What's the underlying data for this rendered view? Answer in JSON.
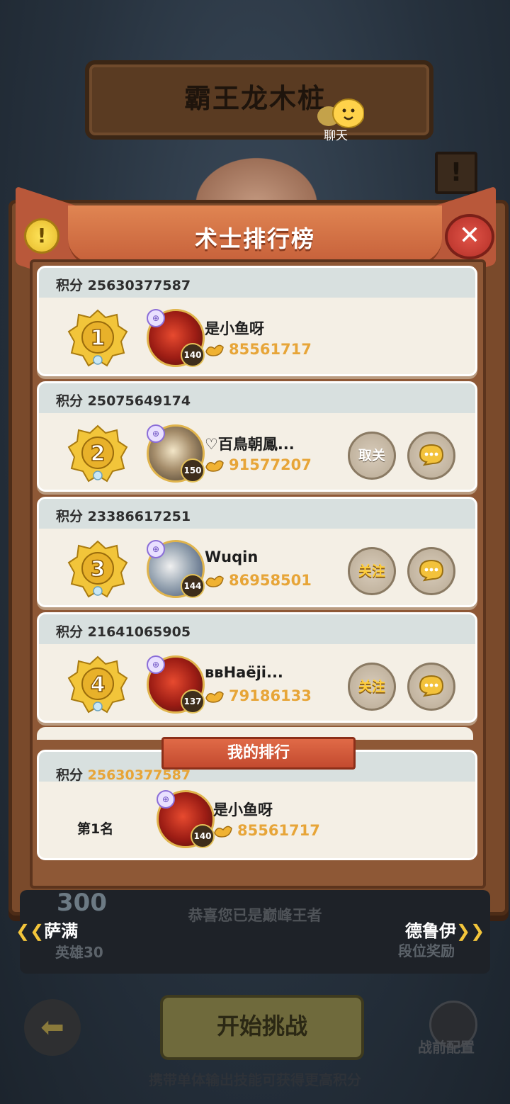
{
  "stage_title": "霸王龙木桩",
  "chat_label": "聊天",
  "panel_title": "术士排行榜",
  "score_prefix": "积分",
  "rows": [
    {
      "rank": "1",
      "score": "25630377587",
      "name": "是小鱼呀",
      "level": "140",
      "power": "85561717",
      "buttons": []
    },
    {
      "rank": "2",
      "score": "25075649174",
      "name": "♡百鳥朝鳳...",
      "level": "150",
      "power": "91577207",
      "follow_label": "取关",
      "buttons": [
        "unfollow",
        "chat"
      ]
    },
    {
      "rank": "3",
      "score": "23386617251",
      "name": "Wuqin",
      "level": "144",
      "power": "86958501",
      "follow_label": "关注",
      "buttons": [
        "follow",
        "chat"
      ]
    },
    {
      "rank": "4",
      "score": "21641065905",
      "name": "вв­Haëji...",
      "level": "137",
      "power": "79186133",
      "follow_label": "关注",
      "buttons": [
        "follow",
        "chat"
      ]
    }
  ],
  "my_rank": {
    "tag": "我的排行",
    "score": "25630377587",
    "position": "第1名",
    "name": "是小鱼呀",
    "level": "140",
    "power": "85561717"
  },
  "bottom": {
    "congrats": "恭喜您已是巅峰王者",
    "badge_number": "300",
    "left_nav": "萨满",
    "left_sub": "英雄30",
    "right_nav": "德鲁伊",
    "right_sub": "段位奖励",
    "start_label": "开始挑战",
    "config_label": "战前配置",
    "tip": "携带单体输出技能可获得更高积分"
  }
}
